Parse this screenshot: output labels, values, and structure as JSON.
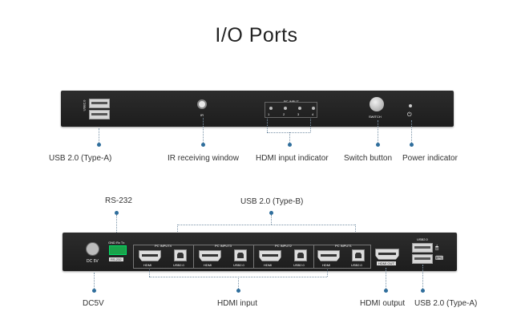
{
  "title": "I/O Ports",
  "front_panel": {
    "usb_port_label": "USB2.0",
    "ir_label": "IR",
    "pc_input_label": "PC INPUT",
    "input_numbers": [
      "1",
      "2",
      "3",
      "4"
    ],
    "switch_label": "SWITCH",
    "power_icon": "power-icon",
    "callouts": {
      "usb": "USB 2.0 (Type-A)",
      "ir": "IR receiving window",
      "hdmi_indicator": "HDMI input indicator",
      "switch": "Switch button",
      "power": "Power indicator"
    }
  },
  "rear_panel": {
    "dc_label": "DC 5V",
    "rs232_pins": "GND Rx Tx",
    "rs232_label": "RS-232",
    "inputs": [
      {
        "header": "PC INPUT4",
        "hdmi": "HDMI",
        "usb": "USB2.0"
      },
      {
        "header": "PC INPUT3",
        "hdmi": "HDMI",
        "usb": "USB2.0"
      },
      {
        "header": "PC INPUT2",
        "hdmi": "HDMI",
        "usb": "USB2.0"
      },
      {
        "header": "PC INPUT1",
        "hdmi": "HDMI",
        "usb": "USB2.0"
      }
    ],
    "hdmi_out_label": "HDMI OUT",
    "usb_out_label": "USB2.0",
    "callouts": {
      "rs232": "RS-232",
      "usb_b": "USB 2.0 (Type-B)",
      "dc": "DC5V",
      "hdmi_input": "HDMI input",
      "hdmi_output": "HDMI output",
      "usb_a": "USB 2.0 (Type-A)"
    }
  }
}
